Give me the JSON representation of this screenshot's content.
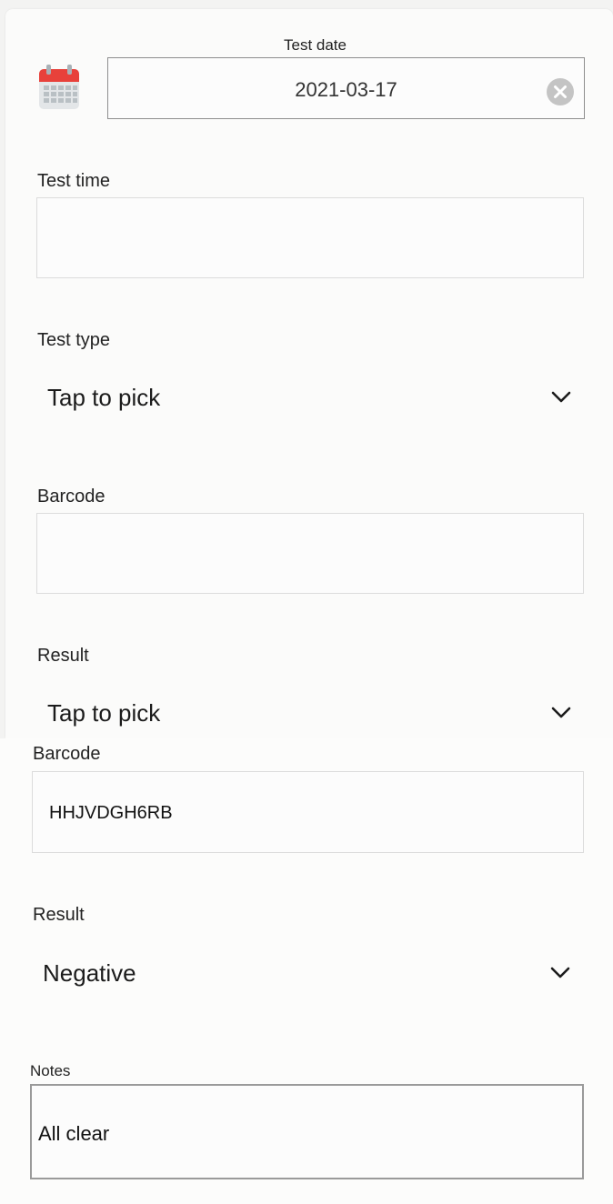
{
  "top_form": {
    "test_date": {
      "label": "Test date",
      "value": "2021-03-17"
    },
    "test_time": {
      "label": "Test time",
      "value": ""
    },
    "test_type": {
      "label": "Test type",
      "value": "Tap to pick"
    },
    "barcode": {
      "label": "Barcode",
      "value": ""
    },
    "result": {
      "label": "Result",
      "value": "Tap to pick"
    }
  },
  "bottom_form": {
    "barcode": {
      "label": "Barcode",
      "value": "HHJVDGH6RB"
    },
    "result": {
      "label": "Result",
      "value": "Negative"
    },
    "notes": {
      "label": "Notes",
      "value": "All clear"
    }
  },
  "icons": {
    "calendar": "calendar-icon",
    "clear": "clear-circle-icon",
    "chevron": "chevron-down-icon"
  },
  "colors": {
    "calendar_red": "#e8413b",
    "clear_grey": "#c4c4c4"
  }
}
